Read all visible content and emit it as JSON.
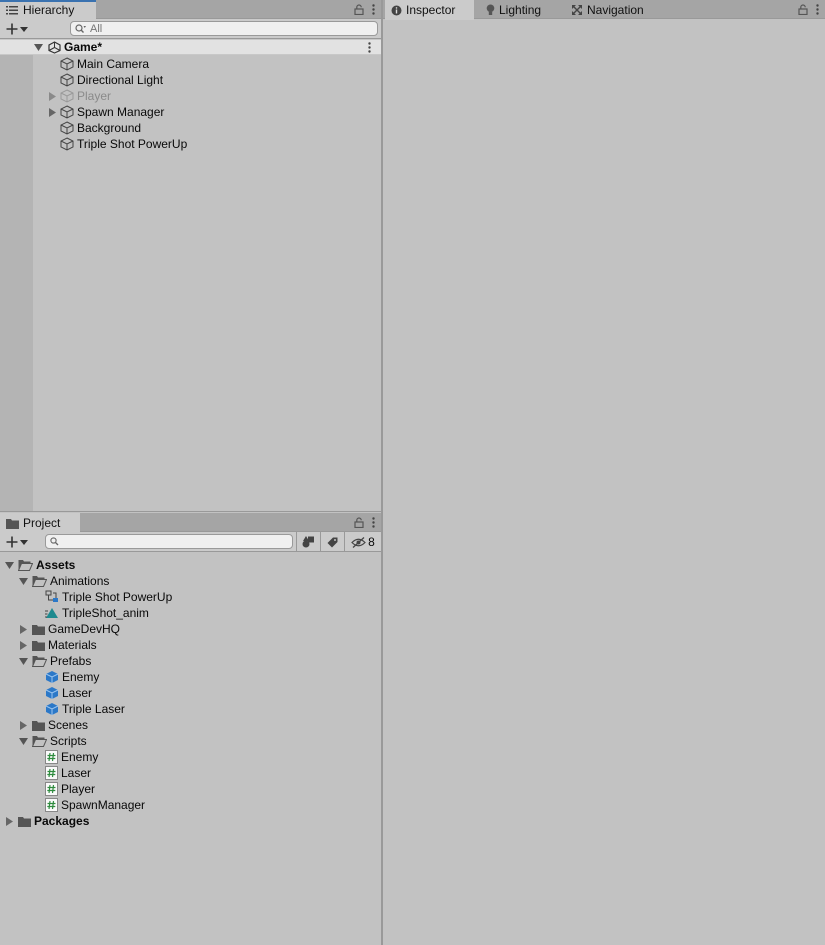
{
  "hierarchy": {
    "tab_label": "Hierarchy",
    "search_placeholder": "All",
    "scene_name": "Game*",
    "items": [
      {
        "label": "Main Camera",
        "dim": false,
        "expandable": false
      },
      {
        "label": "Directional Light",
        "dim": false,
        "expandable": false
      },
      {
        "label": "Player",
        "dim": true,
        "expandable": true
      },
      {
        "label": "Spawn Manager",
        "dim": false,
        "expandable": true
      },
      {
        "label": "Background",
        "dim": false,
        "expandable": false
      },
      {
        "label": "Triple Shot PowerUp",
        "dim": false,
        "expandable": false
      }
    ]
  },
  "project": {
    "tab_label": "Project",
    "search_placeholder": "",
    "hidden_count": "8",
    "tree": [
      {
        "label": "Assets",
        "bold": true
      },
      {
        "label": "Animations"
      },
      {
        "label": "Triple Shot PowerUp"
      },
      {
        "label": "TripleShot_anim"
      },
      {
        "label": "GameDevHQ"
      },
      {
        "label": "Materials"
      },
      {
        "label": "Prefabs"
      },
      {
        "label": "Enemy"
      },
      {
        "label": "Laser"
      },
      {
        "label": "Triple Laser"
      },
      {
        "label": "Scenes"
      },
      {
        "label": "Scripts"
      },
      {
        "label": "Enemy"
      },
      {
        "label": "Laser"
      },
      {
        "label": "Player"
      },
      {
        "label": "SpawnManager"
      },
      {
        "label": "Packages",
        "bold": true
      }
    ]
  },
  "inspector": {
    "tabs": [
      "Inspector",
      "Lighting",
      "Navigation"
    ]
  },
  "colors": {
    "accent": "#3a72b0",
    "panel": "#c2c2c2",
    "prefab_blue": "#2b78c8",
    "script_green": "#2e8b3e"
  }
}
